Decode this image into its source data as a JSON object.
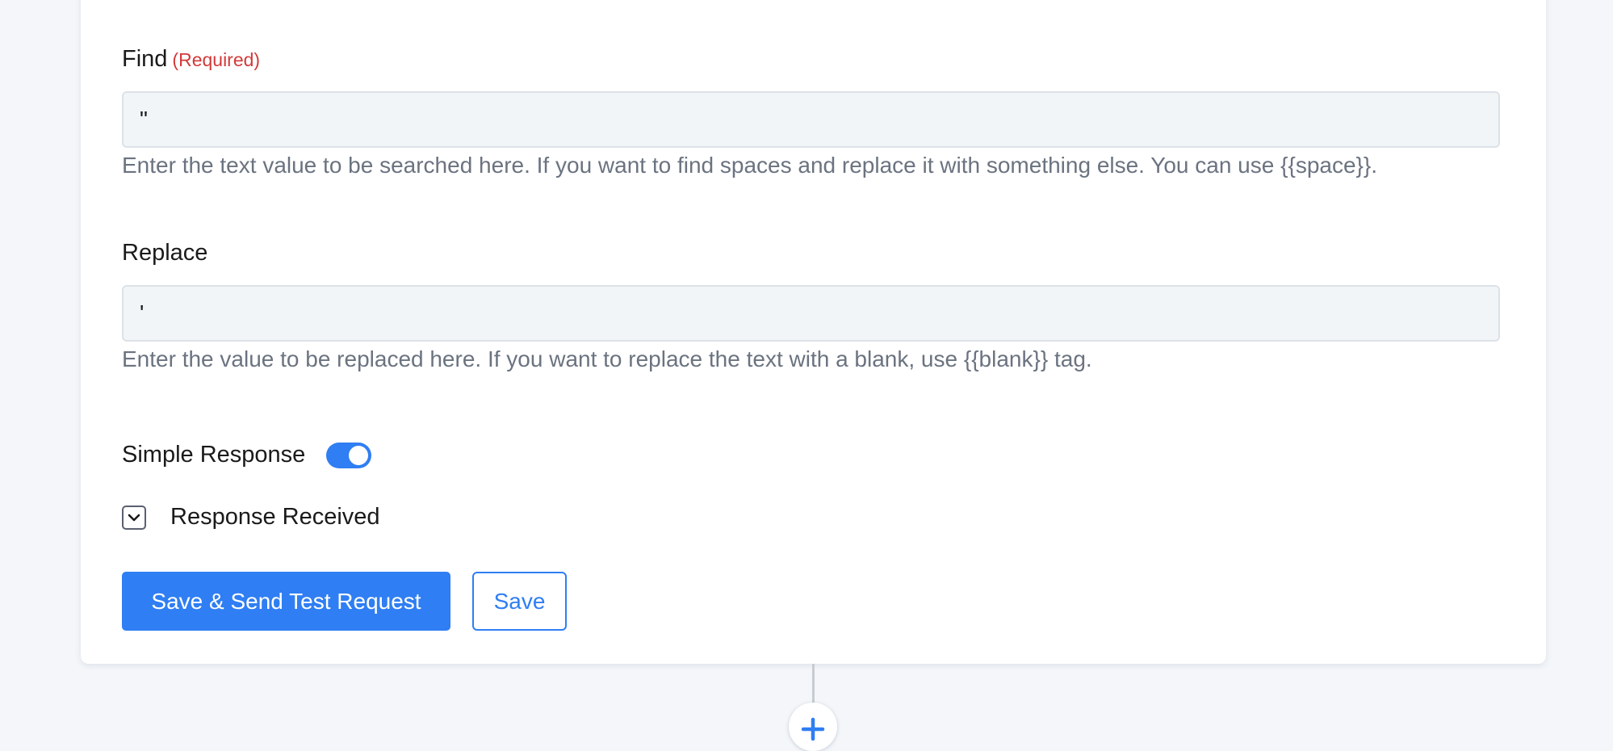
{
  "find": {
    "label": "Find",
    "required_text": "(Required)",
    "value": "\"",
    "help": "Enter the text value to be searched here. If you want to find spaces and replace it with something else. You can use {{space}}."
  },
  "replace": {
    "label": "Replace",
    "value": "'",
    "help": "Enter the value to be replaced here. If you want to replace the text with a blank, use {{blank}} tag."
  },
  "simple_response": {
    "label": "Simple Response",
    "enabled": true
  },
  "response_received": {
    "label": "Response Received",
    "icon": "chevron-down-icon"
  },
  "actions": {
    "save_send_label": "Save & Send Test Request",
    "save_label": "Save"
  },
  "add_step": {
    "icon": "plus-icon"
  },
  "colors": {
    "accent": "#2f7ef3",
    "required": "#d33a3a",
    "help_text": "#6b7380",
    "input_bg": "#f2f5f8",
    "page_bg": "#f4f6f9"
  }
}
